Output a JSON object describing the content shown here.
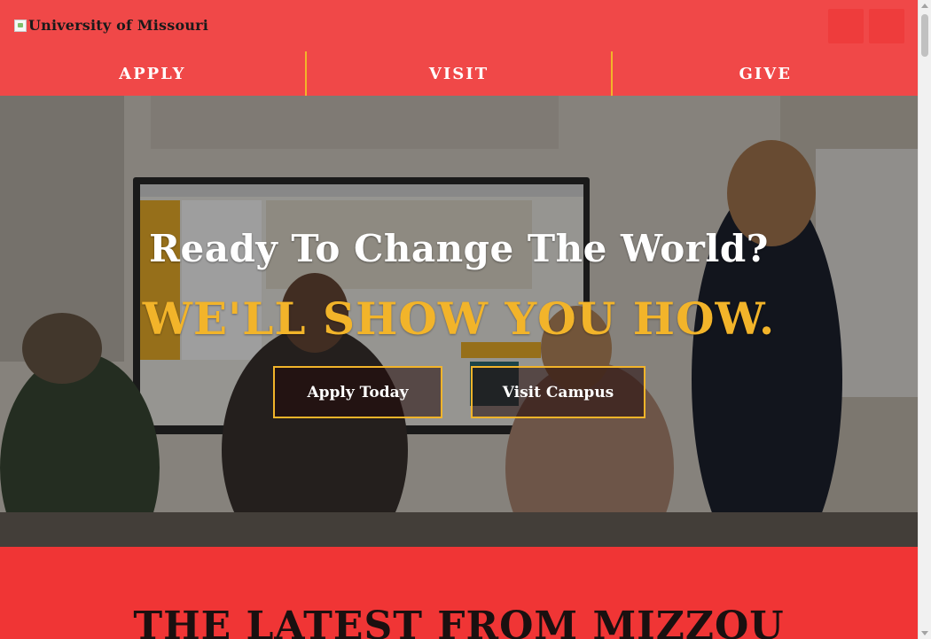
{
  "header": {
    "logo_text": "University of Missouri"
  },
  "nav": {
    "items": [
      {
        "label": "APPLY"
      },
      {
        "label": "VISIT"
      },
      {
        "label": "GIVE"
      }
    ]
  },
  "hero": {
    "title": "Ready To Change The World?",
    "subtitle": "WE'LL SHOW YOU HOW.",
    "buttons": [
      {
        "label": "Apply Today"
      },
      {
        "label": "Visit Campus"
      }
    ]
  },
  "latest": {
    "title": "THE LATEST FROM MIZZOU"
  },
  "colors": {
    "header_red": "#f04848",
    "accent_gold": "#f2b42a",
    "section_red": "#f03535"
  }
}
